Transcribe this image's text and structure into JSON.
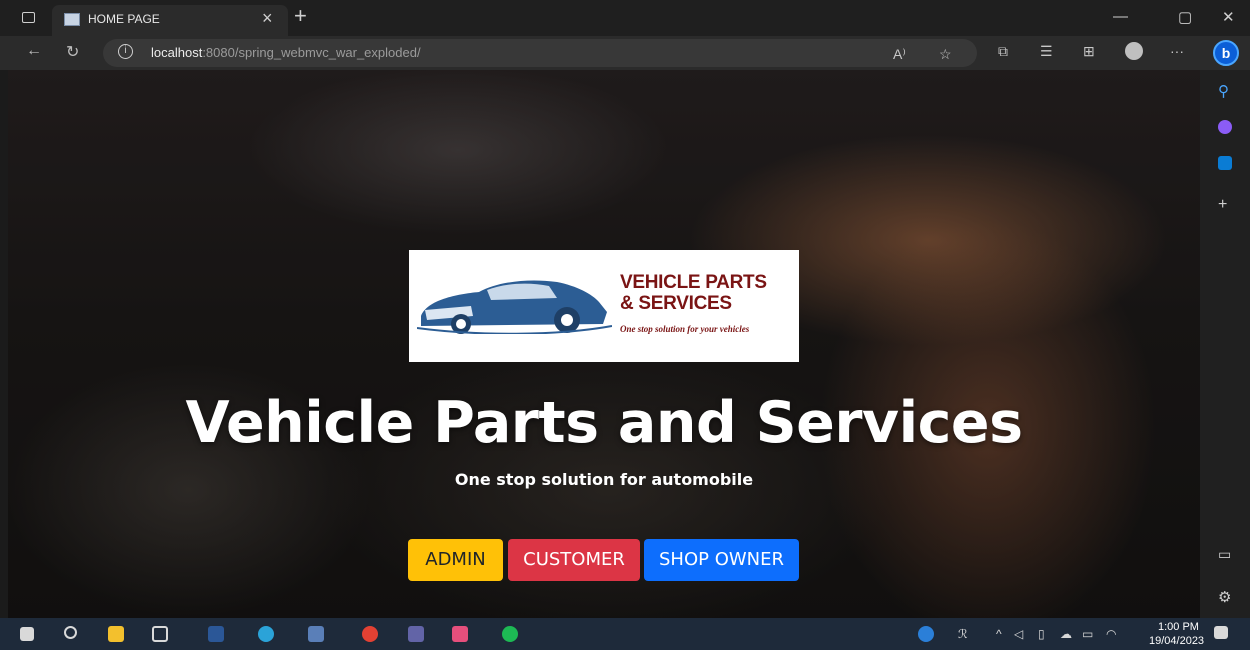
{
  "tab": {
    "title": "HOME PAGE",
    "close_glyph": "×",
    "new_glyph": "+"
  },
  "window_controls": {
    "minimize": "—",
    "restore": "▢",
    "close": "✕"
  },
  "address_bar": {
    "url_host": "localhost",
    "url_rest": ":8080/spring_webmvc_war_exploded/",
    "info_glyph": "i"
  },
  "toolbar_icons": [
    "read-aloud-icon",
    "favorites-add-icon",
    "extensions-icon",
    "favorites-icon",
    "collections-icon",
    "profile-icon",
    "more-icon",
    "bing-icon"
  ],
  "toolbar_glyphs": {
    "read_aloud": "A⁾",
    "star": "☆",
    "puzzle": "⧉",
    "favorites": "☰",
    "collections": "⊞",
    "more": "···",
    "bing": "b"
  },
  "nav_glyphs": {
    "back": "←",
    "refresh": "↻"
  },
  "sidebar_icons": [
    "search-icon",
    "copilot-icon",
    "outlook-icon",
    "add-icon",
    "hide-sidebar-icon",
    "settings-icon"
  ],
  "sidebar_glyphs": {
    "search": "⚲",
    "add": "+",
    "hide": "▭",
    "settings": "⚙"
  },
  "logo": {
    "title_line1": "VEHICLE PARTS",
    "title_line2": "& SERVICES",
    "tagline": "One stop solution for your vehicles"
  },
  "hero": {
    "title": "Vehicle Parts and Services",
    "subtitle": "One stop solution for automobile"
  },
  "buttons": {
    "admin": "ADMIN",
    "customer": "CUSTOMER",
    "shop_owner": "SHOP OWNER"
  },
  "colors": {
    "admin": "#ffc107",
    "customer": "#dc3545",
    "shop_owner": "#0d6efd",
    "logo_text": "#7a1414"
  },
  "taskbar": {
    "apps": [
      "windows-start-icon",
      "search-icon",
      "file-explorer-icon",
      "3d-viewer-icon",
      "word-icon",
      "edge-icon",
      "photos-icon",
      "chrome-icon",
      "teams-icon",
      "intellij-icon",
      "spotify-icon"
    ],
    "time": "1:00 PM",
    "date": "19/04/2023"
  }
}
